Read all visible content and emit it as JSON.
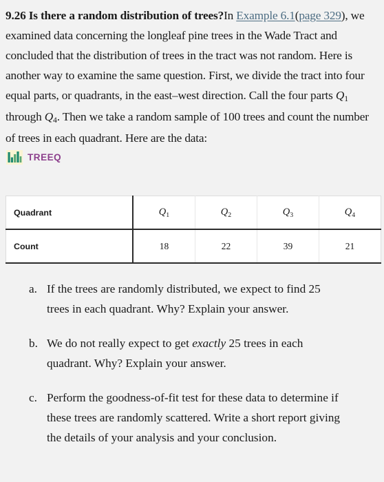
{
  "exercise": {
    "number": "9.26",
    "title": "Is there a random distribution of trees?",
    "intro_pre": "In ",
    "link_example": "Example 6.1",
    "paren_open": "(",
    "link_page": "page 329",
    "body": "), we examined data concerning the longleaf pine trees in the Wade Tract and concluded that the distribution of trees in the tract was not random. Here is another way to examine the same question. First, we divide the tract into four equal parts, or quadrants, in the east–west direction. Call the four parts ",
    "var_first": "Q",
    "var_first_sub": "1",
    "body_mid": " through ",
    "var_last": "Q",
    "var_last_sub": "4",
    "body_end": ". Then we take a random sample of 100 trees and count the number of trees in each quadrant. Here are the data:"
  },
  "dataset": {
    "icon": "bar-chart-icon",
    "label": "TREEQ",
    "label_color": "#8c3f8c",
    "icon_bg": "#faf4d2",
    "icon_bar_colors": [
      "#1f8a70",
      "#1f8a70",
      "#57a773",
      "#1f8a70",
      "#57a773"
    ]
  },
  "table": {
    "row_labels": [
      "Quadrant",
      "Count"
    ],
    "quadrants": [
      {
        "var": "Q",
        "sub": "1"
      },
      {
        "var": "Q",
        "sub": "2"
      },
      {
        "var": "Q",
        "sub": "3"
      },
      {
        "var": "Q",
        "sub": "4"
      }
    ],
    "counts": [
      "18",
      "22",
      "39",
      "21"
    ]
  },
  "parts": [
    {
      "marker": "a.",
      "text_pre": "If the trees are randomly distributed, we expect to find 25 trees in each quadrant. Why? Explain your answer.",
      "emphasis": "",
      "text_post": ""
    },
    {
      "marker": "b.",
      "text_pre": "We do not really expect to get ",
      "emphasis": "exactly",
      "text_post": " 25 trees in each quadrant. Why? Explain your answer."
    },
    {
      "marker": "c.",
      "text_pre": "Perform the goodness-of-fit test for these data to determine if these trees are randomly scattered. Write a short report giving the details of your analysis and your conclusion.",
      "emphasis": "",
      "text_post": ""
    }
  ],
  "colors": {
    "page_background": "#f2f2f2",
    "text": "#1a1a1a",
    "link": "#4c6c82",
    "rule": "#2b2b2b"
  }
}
